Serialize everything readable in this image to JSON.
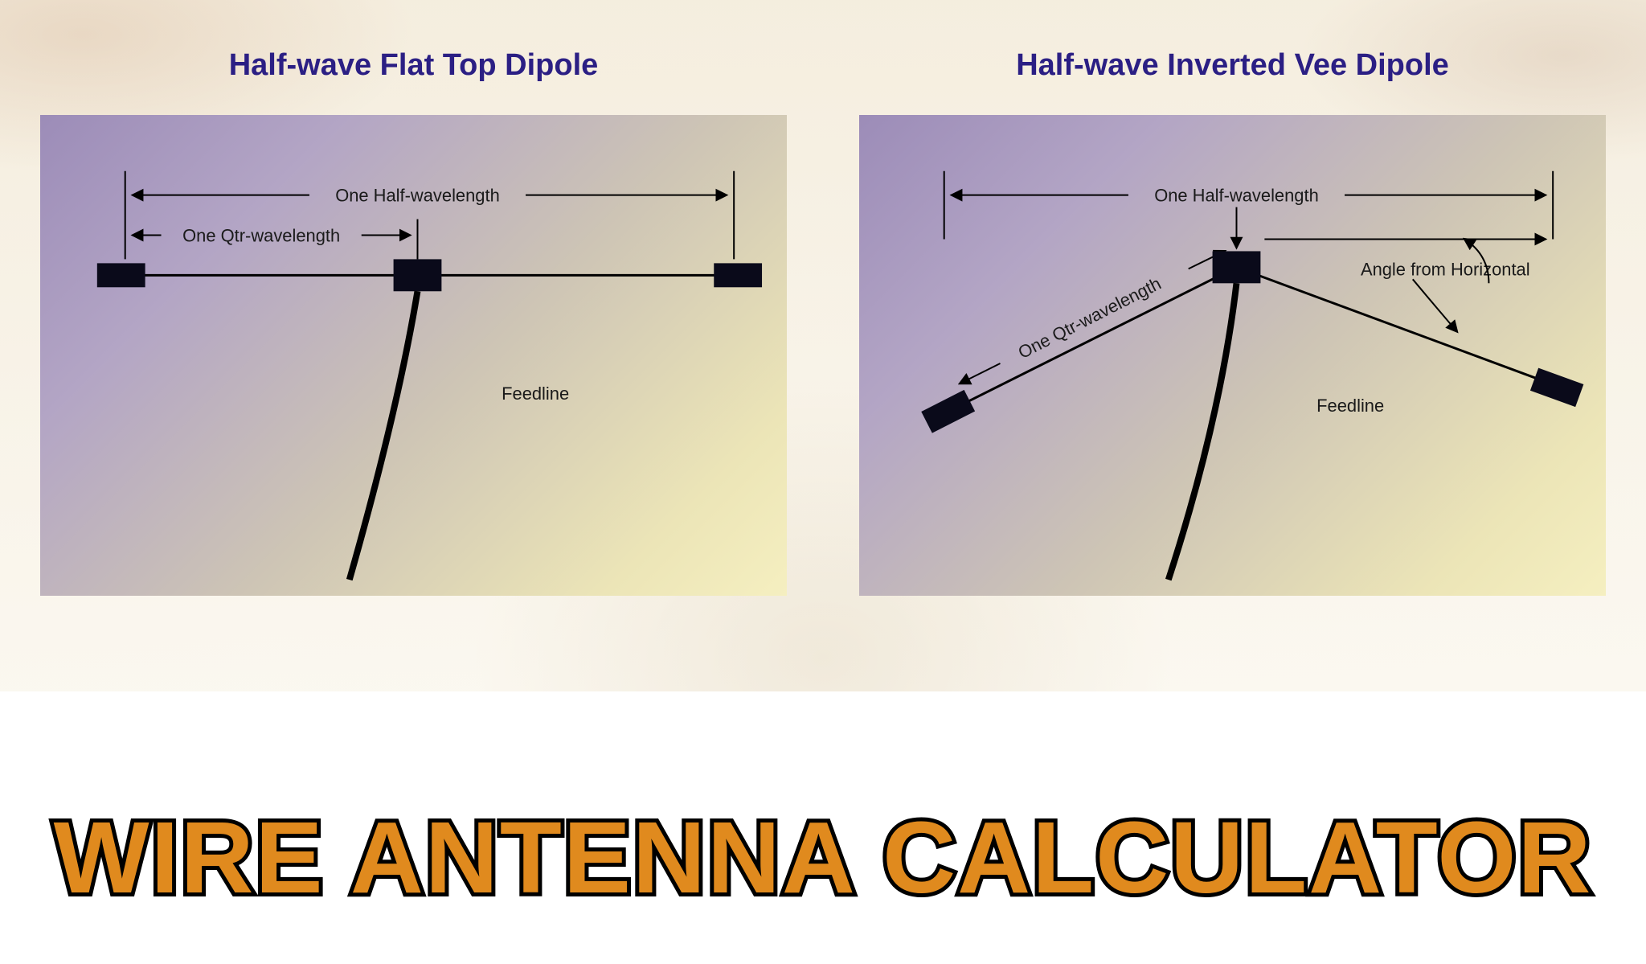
{
  "page_title": "WIRE ANTENNA CALCULATOR",
  "left": {
    "title": "Half-wave Flat Top Dipole",
    "labels": {
      "half_wavelength": "One Half-wavelength",
      "qtr_wavelength": "One Qtr-wavelength",
      "feedline": "Feedline"
    }
  },
  "right": {
    "title": "Half-wave Inverted Vee Dipole",
    "labels": {
      "half_wavelength": "One Half-wavelength",
      "qtr_wavelength": "One Qtr-wavelength",
      "feedline": "Feedline",
      "angle": "Angle from Horizontal"
    }
  }
}
